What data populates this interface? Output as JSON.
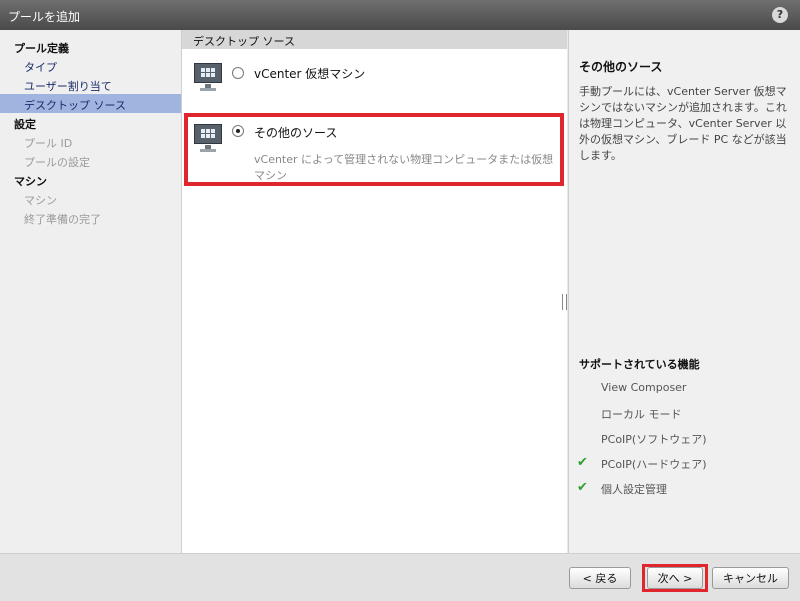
{
  "dialog": {
    "title": "プールを追加",
    "help_label": "?"
  },
  "sidebar": {
    "sections": [
      {
        "label": "プール定義",
        "items": [
          {
            "label": "タイプ",
            "state": "normal"
          },
          {
            "label": "ユーザー割り当て",
            "state": "normal"
          },
          {
            "label": "デスクトップ ソース",
            "state": "selected"
          }
        ]
      },
      {
        "label": "設定",
        "items": [
          {
            "label": "プール ID",
            "state": "disabled"
          },
          {
            "label": "プールの設定",
            "state": "disabled"
          }
        ]
      },
      {
        "label": "マシン",
        "items": [
          {
            "label": "マシン",
            "state": "disabled"
          },
          {
            "label": "終了準備の完了",
            "state": "disabled"
          }
        ]
      }
    ]
  },
  "center": {
    "header": "デスクトップ ソース",
    "options": [
      {
        "label": "vCenter 仮想マシン",
        "selected": false,
        "description": ""
      },
      {
        "label": "その他のソース",
        "selected": true,
        "description": "vCenter によって管理されない物理コンピュータまたは仮想マシン"
      }
    ]
  },
  "right_panel": {
    "title": "その他のソース",
    "description": "手動プールには、vCenter Server 仮想マシンではないマシンが追加されます。これは物理コンピュータ、vCenter Server 以外の仮想マシン、ブレード PC などが該当します。",
    "features_title": "サポートされている機能",
    "features": [
      {
        "label": "View Composer",
        "supported": false
      },
      {
        "label": "ローカル モード",
        "supported": false
      },
      {
        "label": "PCoIP(ソフトウェア)",
        "supported": false
      },
      {
        "label": "PCoIP(ハードウェア)",
        "supported": true
      },
      {
        "label": "個人設定管理",
        "supported": true
      }
    ]
  },
  "footer": {
    "back_label": "< 戻る",
    "next_label": "次へ >",
    "cancel_label": "キャンセル"
  },
  "colors": {
    "highlight": "#e0252f",
    "selected_nav": "#9fb4df",
    "check": "#2e9e2e"
  }
}
